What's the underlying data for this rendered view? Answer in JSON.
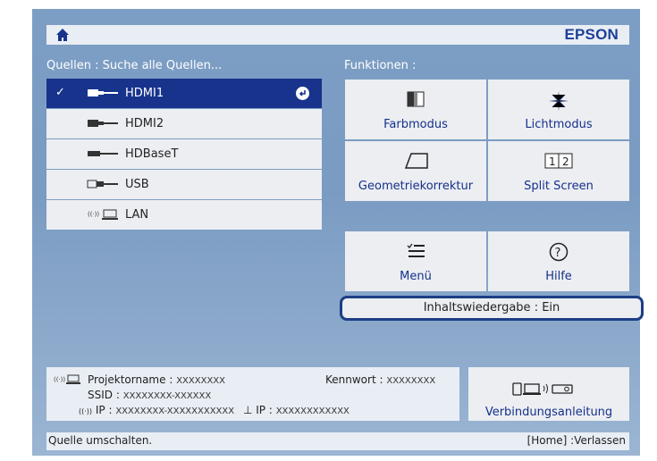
{
  "header": {
    "brand": "EPSON",
    "home_icon": "home-icon"
  },
  "sources": {
    "title": "Quellen : Suche alle Quellen...",
    "items": [
      {
        "label": "HDMI1",
        "icon": "hdmi-connector-icon",
        "selected": true
      },
      {
        "label": "HDMI2",
        "icon": "hdmi-connector-icon",
        "selected": false
      },
      {
        "label": "HDBaseT",
        "icon": "hdbaset-connector-icon",
        "selected": false
      },
      {
        "label": "USB",
        "icon": "usb-connector-icon",
        "selected": false
      },
      {
        "label": "LAN",
        "icon": "lan-icon",
        "selected": false
      }
    ]
  },
  "functions": {
    "title": "Funktionen :",
    "items": [
      {
        "label": "Farbmodus",
        "icon": "color-mode-icon"
      },
      {
        "label": "Lichtmodus",
        "icon": "light-mode-icon"
      },
      {
        "label": "Geometriekorrektur",
        "icon": "geometry-correction-icon"
      },
      {
        "label": "Split Screen",
        "icon": "split-screen-icon"
      },
      {
        "label": "Menü",
        "icon": "menu-icon"
      },
      {
        "label": "Hilfe",
        "icon": "help-icon"
      }
    ],
    "content_playback": "Inhaltswiedergabe : Ein"
  },
  "info": {
    "projector_name_label": "Projektorname :",
    "projector_name_value": "XXXXXXXX",
    "password_label": "Kennwort :",
    "password_value": "XXXXXXXX",
    "ssid_label": "SSID :",
    "ssid_value": "XXXXXXXX-XXXXXX",
    "ip_label": "IP :",
    "ip_value": "XXXXXXXX-XXXXXXXXXXX",
    "wired_ip_label": "IP :",
    "wired_ip_value": "XXXXXXXXXXXX"
  },
  "connection_guide": {
    "label": "Verbindungsanleitung"
  },
  "footer": {
    "left": "Quelle umschalten.",
    "right": "[Home] :Verlassen"
  },
  "colors": {
    "panel": "#7d9ec4",
    "selected": "#17338c",
    "accent_text": "#15308a",
    "brand": "#1e3e99"
  }
}
